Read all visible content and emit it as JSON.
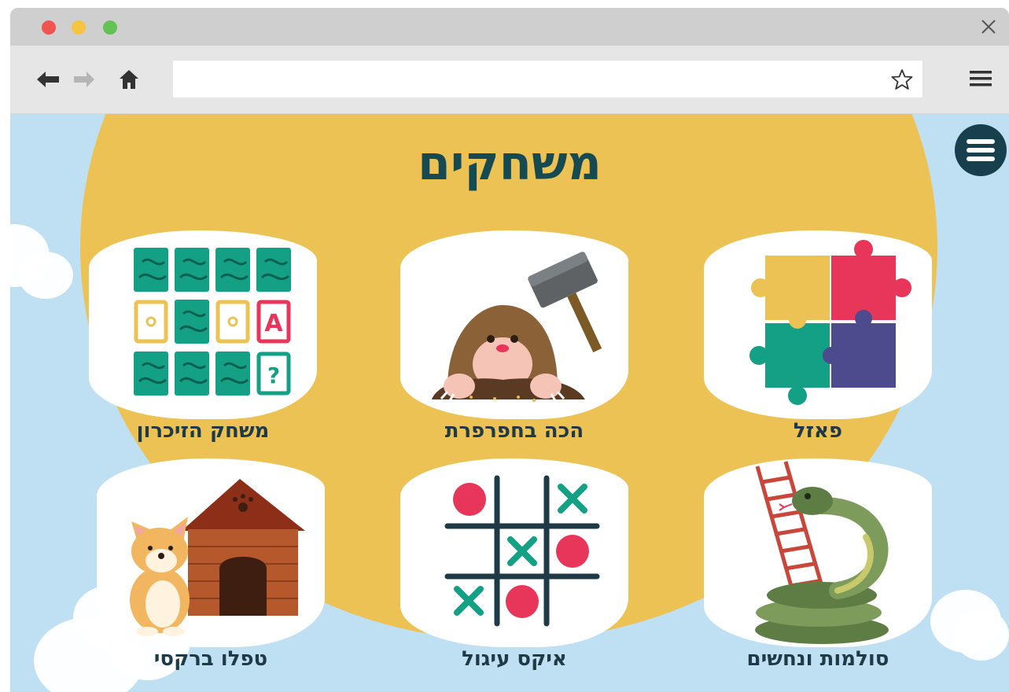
{
  "browser": {
    "address_value": "",
    "address_placeholder": ""
  },
  "page": {
    "title": "משחקים"
  },
  "games": [
    {
      "label": "משחק הזיכרון",
      "icon": "memory-cards-icon"
    },
    {
      "label": "הכה בחפרפרת",
      "icon": "mole-hammer-icon"
    },
    {
      "label": "פאזל",
      "icon": "puzzle-pieces-icon"
    },
    {
      "label": "טפלו ברקסי",
      "icon": "dog-house-icon"
    },
    {
      "label": "איקס עיגול",
      "icon": "tic-tac-toe-icon"
    },
    {
      "label": "סולמות ונחשים",
      "icon": "snake-ladder-icon"
    }
  ],
  "colors": {
    "sky": "#bfe0f3",
    "sun": "#ecc254",
    "title": "#164a52",
    "teal": "#13a085",
    "red": "#e8365a",
    "purple": "#4d4a8d"
  }
}
